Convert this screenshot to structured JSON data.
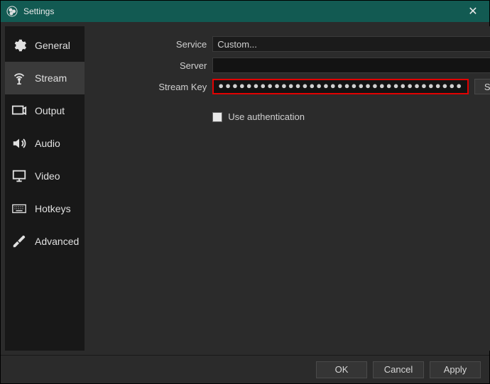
{
  "window": {
    "title": "Settings"
  },
  "sidebar": {
    "items": [
      {
        "label": "General"
      },
      {
        "label": "Stream"
      },
      {
        "label": "Output"
      },
      {
        "label": "Audio"
      },
      {
        "label": "Video"
      },
      {
        "label": "Hotkeys"
      },
      {
        "label": "Advanced"
      }
    ],
    "active_index": 1
  },
  "form": {
    "service": {
      "label": "Service",
      "value": "Custom..."
    },
    "server": {
      "label": "Server",
      "value": ""
    },
    "stream_key": {
      "label": "Stream Key",
      "masked_value": "●●●●●●●●●●●●●●●●●●●●●●●●●●●●●●●●●●●",
      "show_button": "Show"
    },
    "auth": {
      "label": "Use authentication",
      "checked": false
    }
  },
  "footer": {
    "ok": "OK",
    "cancel": "Cancel",
    "apply": "Apply"
  }
}
